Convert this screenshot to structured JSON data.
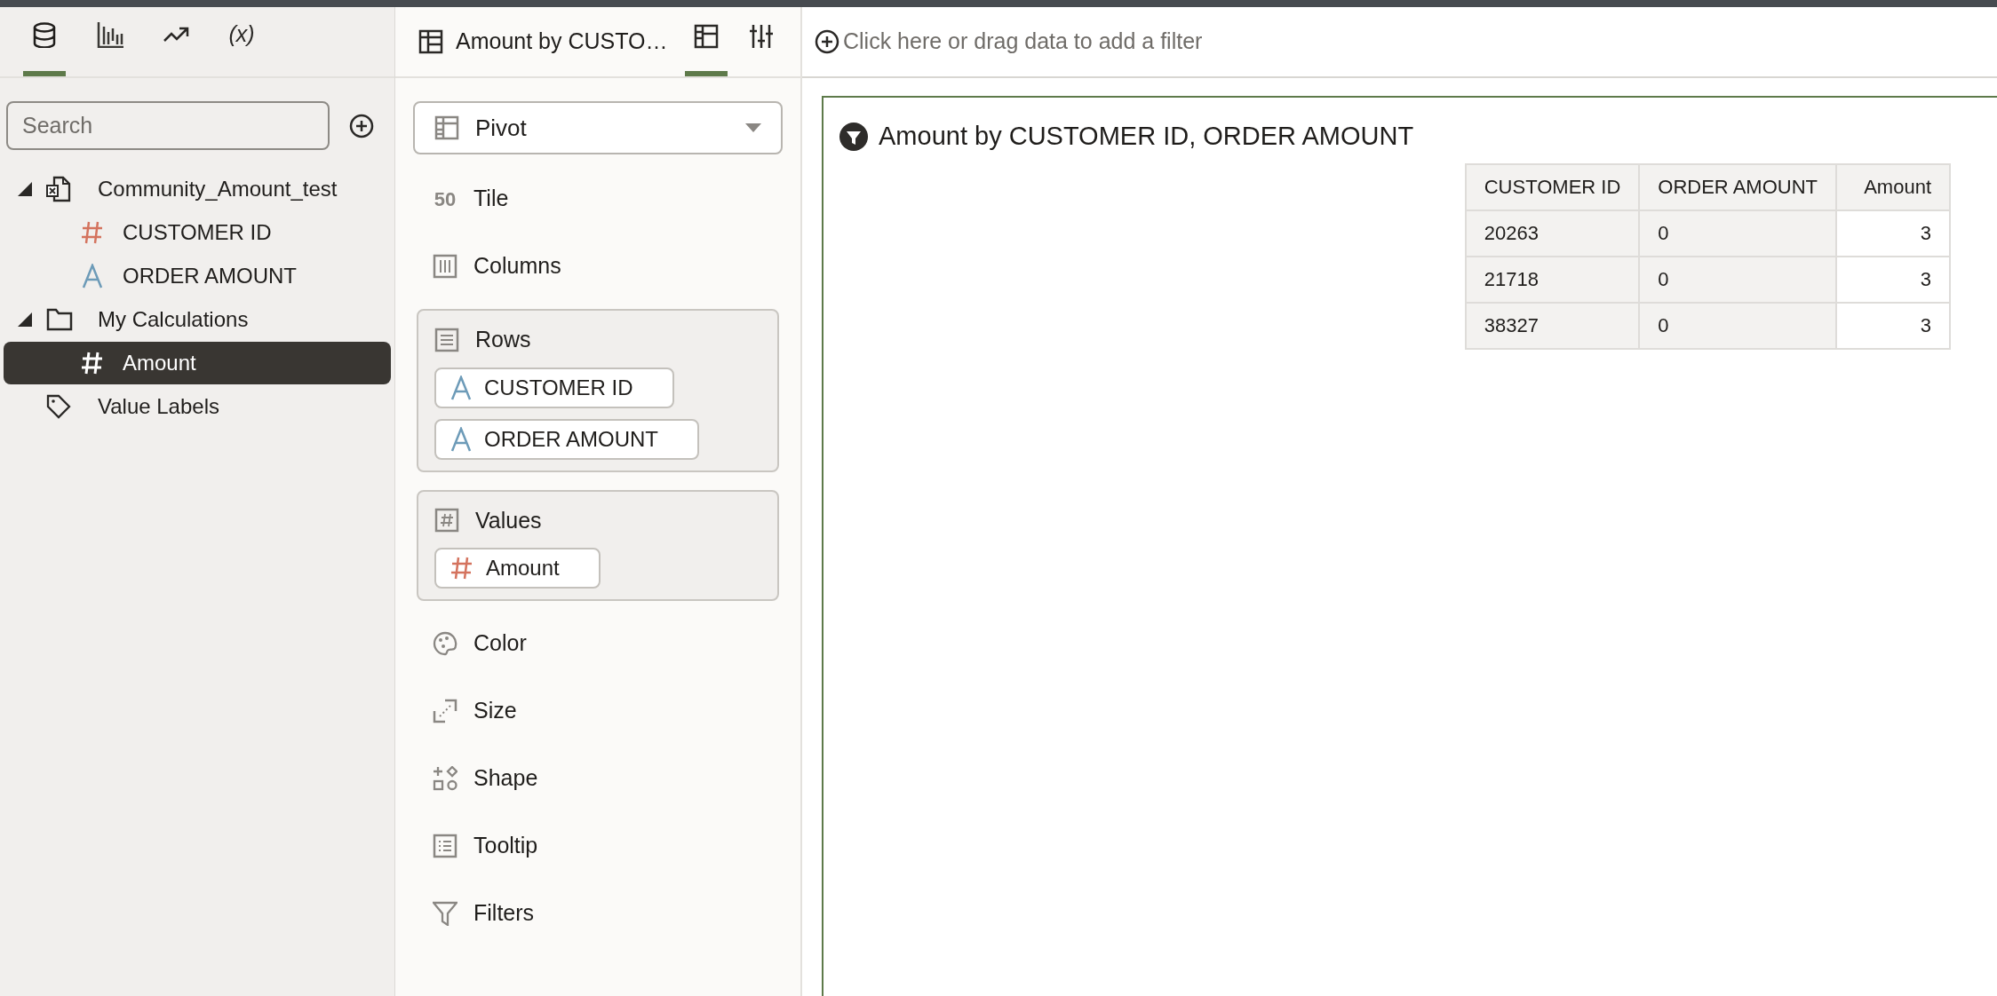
{
  "left_tabs": [
    {
      "kind": "data",
      "selected": true
    },
    {
      "kind": "visualizations",
      "selected": false
    },
    {
      "kind": "analytics",
      "selected": false
    },
    {
      "kind": "variables",
      "label": "(x)",
      "selected": false
    }
  ],
  "search": {
    "placeholder": "Search"
  },
  "tree": [
    {
      "kind": "dataset",
      "label": "Community_Amount_test",
      "expanded": true,
      "selected": false,
      "children": [
        {
          "kind": "measure",
          "label": "CUSTOMER ID",
          "selected": false
        },
        {
          "kind": "attribute",
          "label": "ORDER AMOUNT",
          "selected": false
        }
      ]
    },
    {
      "kind": "folder",
      "label": "My Calculations",
      "expanded": true,
      "selected": false,
      "children": [
        {
          "kind": "measure",
          "label": "Amount",
          "selected": true
        }
      ]
    },
    {
      "kind": "tag",
      "label": "Value Labels",
      "selected": false
    }
  ],
  "viz_header": {
    "title": "Amount by CUSTO…",
    "tabs": [
      {
        "kind": "grammar",
        "selected": true
      },
      {
        "kind": "properties",
        "selected": false
      }
    ]
  },
  "viz_type": {
    "value": "Pivot"
  },
  "grammar": [
    {
      "kind": "tile",
      "label": "Tile",
      "icon_text": "50"
    },
    {
      "kind": "columns",
      "label": "Columns"
    },
    {
      "kind": "rows",
      "label": "Rows",
      "fields": [
        {
          "kind": "attribute",
          "label": "CUSTOMER ID"
        },
        {
          "kind": "attribute",
          "label": "ORDER AMOUNT"
        }
      ]
    },
    {
      "kind": "values",
      "label": "Values",
      "fields": [
        {
          "kind": "measure",
          "label": "Amount"
        }
      ]
    },
    {
      "kind": "color",
      "label": "Color"
    },
    {
      "kind": "size",
      "label": "Size"
    },
    {
      "kind": "shape",
      "label": "Shape"
    },
    {
      "kind": "tooltip",
      "label": "Tooltip"
    },
    {
      "kind": "filters",
      "label": "Filters"
    }
  ],
  "filter_bar": {
    "placeholder": "Click here or drag data to add a filter"
  },
  "canvas": {
    "title": "Amount by CUSTOMER ID, ORDER AMOUNT",
    "table": {
      "columns": [
        "CUSTOMER ID",
        "ORDER AMOUNT",
        "Amount"
      ],
      "rows": [
        [
          "20263",
          "0",
          "3"
        ],
        [
          "21718",
          "0",
          "3"
        ],
        [
          "38327",
          "0",
          "3"
        ]
      ]
    }
  }
}
